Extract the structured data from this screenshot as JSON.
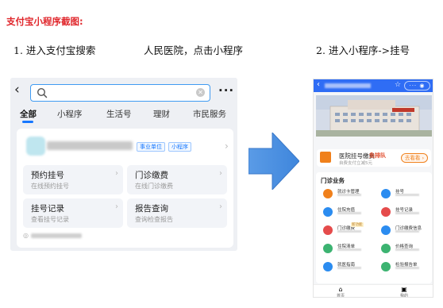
{
  "heading": "支付宝小程序截图:",
  "steps": {
    "step1": "1. 进入支付宝搜索",
    "step1_detail": "人民医院，点击小程序",
    "step2": "2. 进入小程序->挂号"
  },
  "search_screen": {
    "tabs": [
      "全部",
      "小程序",
      "生活号",
      "理财",
      "市民服务"
    ],
    "active_tab": "全部",
    "result": {
      "tags": [
        "事业单位",
        "小程序"
      ],
      "services": [
        {
          "title": "预约挂号",
          "sub": "在线预约挂号"
        },
        {
          "title": "门诊缴费",
          "sub": "在线门诊缴费"
        },
        {
          "title": "挂号记录",
          "sub": "查看挂号记录"
        },
        {
          "title": "报告查询",
          "sub": "查询检查报告"
        }
      ]
    }
  },
  "mini_program": {
    "register_card": {
      "title": "医院挂号缴费",
      "badge": "免排队",
      "sub": "自费支付立减5元",
      "button": "去看看 ›"
    },
    "section_title": "门诊业务",
    "items": [
      {
        "label": "就诊卡管理",
        "color": "#f0801b"
      },
      {
        "label": "挂号",
        "color": "#2b8cf0"
      },
      {
        "label": "住院充值",
        "color": "#2b8cf0"
      },
      {
        "label": "挂号记录",
        "color": "#e54b4b"
      },
      {
        "label": "门诊缴费",
        "color": "#e54b4b",
        "badge": "新功能"
      },
      {
        "label": "门诊缴费信息",
        "color": "#2b8cf0"
      },
      {
        "label": "住院清单",
        "color": "#3cb371"
      },
      {
        "label": "价格查询",
        "color": "#3cb371"
      },
      {
        "label": "就医指南",
        "color": "#2b8cf0"
      },
      {
        "label": "检验报告单",
        "color": "#3cb371"
      }
    ],
    "tabbar": [
      {
        "label": "首页",
        "icon": "home-icon"
      },
      {
        "label": "我的",
        "icon": "user-icon"
      }
    ]
  },
  "colors": {
    "heading": "#e0262b",
    "accent_blue": "#1677ff",
    "arrow": "#4a8fe0",
    "mini_header": "#2f6df5"
  }
}
